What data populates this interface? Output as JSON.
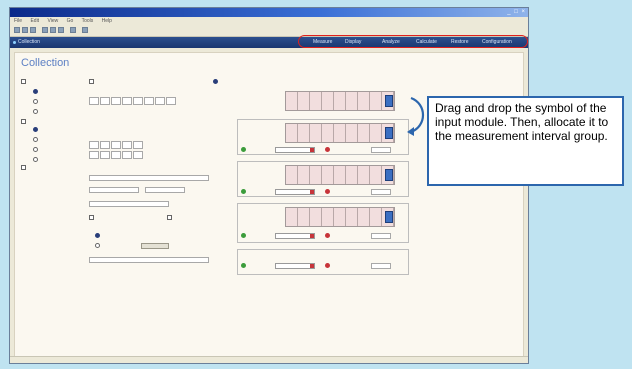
{
  "window": {
    "title": "",
    "window_controls": "_ □ ×"
  },
  "menubar": {
    "items": [
      "File",
      "Edit",
      "View",
      "Go",
      "Tools",
      "Help"
    ]
  },
  "navbar": {
    "title": "Collection",
    "items": [
      "Measure",
      "Display",
      "Analyze",
      "Calculate",
      "Restore",
      "Configuration"
    ]
  },
  "panel": {
    "title": "Collection"
  },
  "callout": {
    "text": "Drag and drop the symbol of the input module. Then, allocate it to the measurement interval group."
  },
  "colors": {
    "callout_border": "#2c66ad",
    "highlight_oval": "#e0201c",
    "accent": "#5d80c4"
  },
  "icons": [
    "curved-arrow-icon",
    "input-module-icon"
  ]
}
